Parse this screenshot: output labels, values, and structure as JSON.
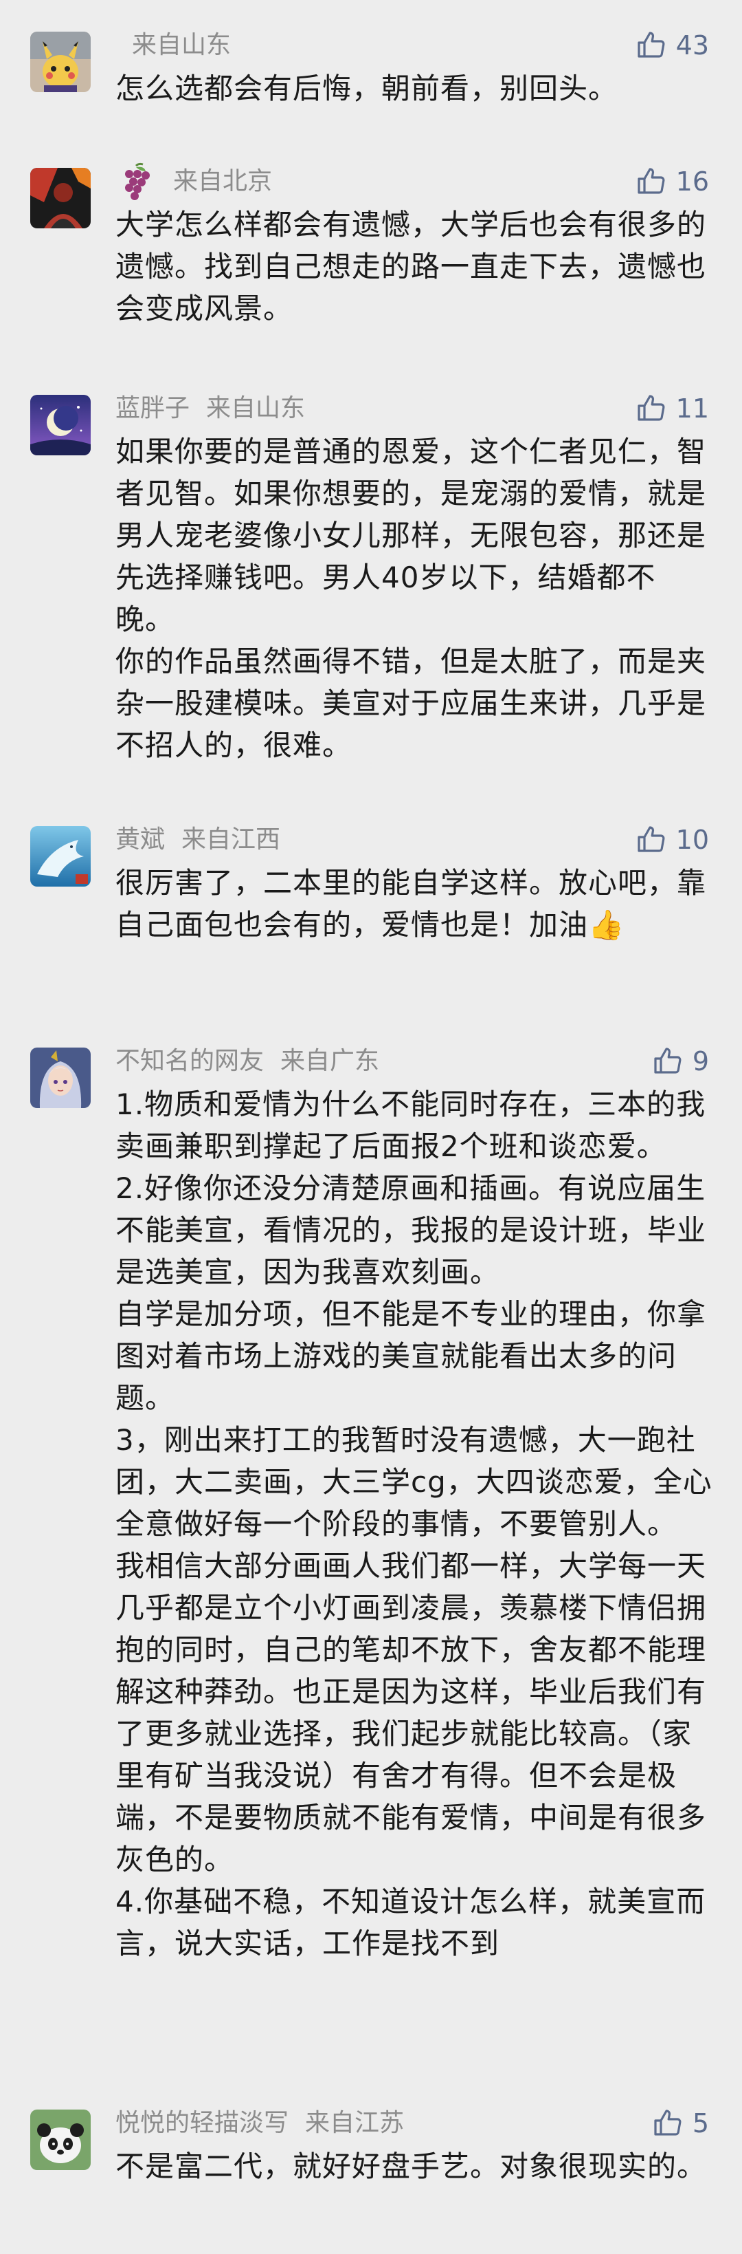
{
  "comments": [
    {
      "nickname": "",
      "location": "来自山东",
      "likes": "43",
      "avatar_icon": "pikachu-avatar-icon",
      "lines": [
        "怎么选都会有后悔，朝前看，别回头。"
      ]
    },
    {
      "nickname": "",
      "location": "来自北京",
      "likes": "16",
      "avatar_icon": "red-figure-avatar-icon",
      "nickname_icon": "grapes-icon",
      "lines": [
        "大学怎么样都会有遗憾，大学后也会有很多的遗憾。找到自己想走的路一直走下去，遗憾也会变成风景。"
      ]
    },
    {
      "nickname": "蓝胖子",
      "location": "来自山东",
      "likes": "11",
      "avatar_icon": "moon-night-avatar-icon",
      "lines": [
        "如果你要的是普通的恩爱，这个仁者见仁，智者见智。如果你想要的，是宠溺的爱情，就是男人宠老婆像小女儿那样，无限包容，那还是先选择赚钱吧。男人40岁以下，结婚都不晚。",
        "你的作品虽然画得不错，但是太脏了，而是夹杂一股建模味。美宣对于应届生来讲，几乎是不招人的，很难。"
      ]
    },
    {
      "nickname": "黄斌",
      "location": "来自江西",
      "likes": "10",
      "avatar_icon": "whale-avatar-icon",
      "lines": [
        "很厉害了，二本里的能自学这样。放心吧，靠自己面包也会有的，爱情也是！加油👍"
      ]
    },
    {
      "nickname": "不知名的网友",
      "location": "来自广东",
      "likes": "9",
      "avatar_icon": "anime-character-avatar-icon",
      "lines": [
        "1.物质和爱情为什么不能同时存在，三本的我卖画兼职到撑起了后面报2个班和谈恋爱。",
        "2.好像你还没分清楚原画和插画。有说应届生不能美宣，看情况的，我报的是设计班，毕业是选美宣，因为我喜欢刻画。",
        "自学是加分项，但不能是不专业的理由，你拿图对着市场上游戏的美宣就能看出太多的问题。",
        "3，刚出来打工的我暂时没有遗憾，大一跑社团，大二卖画，大三学cg，大四谈恋爱，全心全意做好每一个阶段的事情，不要管别人。",
        "我相信大部分画画人我们都一样，大学每一天几乎都是立个小灯画到凌晨，羡慕楼下情侣拥抱的同时，自己的笔却不放下，舍友都不能理解这种莽劲。也正是因为这样，毕业后我们有了更多就业选择，我们起步就能比较高。（家里有矿当我没说）有舍才有得。但不会是极端，不是要物质就不能有爱情，中间是有很多灰色的。",
        "4.你基础不稳，不知道设计怎么样，就美宣而言，说大实话，工作是找不到"
      ]
    },
    {
      "nickname": "悦悦的轻描淡写",
      "location": "来自江苏",
      "likes": "5",
      "avatar_icon": "panda-avatar-icon",
      "lines": [
        "不是富二代，就好好盘手艺。对象很现实的。"
      ]
    }
  ],
  "colors": {
    "background": "#ededed",
    "meta": "#8c8c8c",
    "like": "#5b6b8c",
    "text": "#1a1a1a"
  }
}
